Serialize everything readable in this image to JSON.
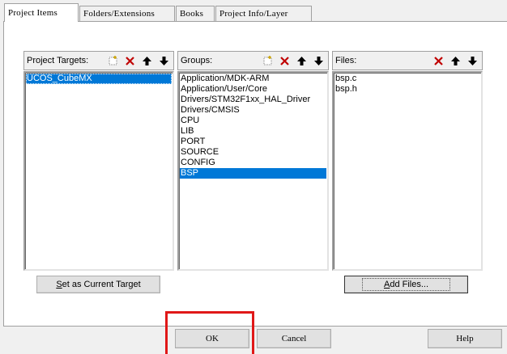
{
  "tabs": [
    {
      "label": "Project Items",
      "active": true
    },
    {
      "label": "Folders/Extensions",
      "active": false
    },
    {
      "label": "Books",
      "active": false
    },
    {
      "label": "Project Info/Layer",
      "active": false
    }
  ],
  "targets": {
    "label": "Project Targets:",
    "items": [
      "UCOS_CubeMX"
    ],
    "selected": "UCOS_CubeMX"
  },
  "groups": {
    "label": "Groups:",
    "items": [
      "Application/MDK-ARM",
      "Application/User/Core",
      "Drivers/STM32F1xx_HAL_Driver",
      "Drivers/CMSIS",
      "CPU",
      "LIB",
      "PORT",
      "SOURCE",
      "CONFIG",
      "BSP"
    ],
    "selected": "BSP"
  },
  "files": {
    "label": "Files:",
    "items": [
      "bsp.c",
      "bsp.h"
    ]
  },
  "buttons": {
    "set_current_target_prefix": "S",
    "set_current_target_rest": "et as Current Target",
    "add_files_prefix": "A",
    "add_files_rest": "dd Files...",
    "ok": "OK",
    "cancel": "Cancel",
    "help": "Help"
  },
  "icons": {
    "new": "new-item-icon",
    "delete": "delete-x-icon",
    "move_up": "arrow-up-icon",
    "move_down": "arrow-down-icon"
  },
  "colors": {
    "selection": "#0078d7",
    "delete_red": "#c00000",
    "annotation_red": "#e01818"
  }
}
